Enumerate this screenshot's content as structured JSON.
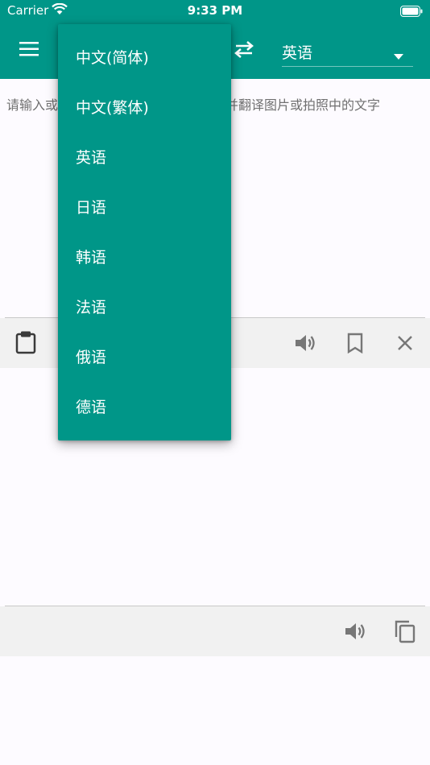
{
  "status": {
    "carrier": "Carrier",
    "time": "9:33 PM"
  },
  "header": {
    "target_language": "英语"
  },
  "input": {
    "placeholder": "请输入或粘贴要翻译的文字，也可识别并翻译图片或拍照中的文字"
  },
  "language_menu": {
    "items": [
      "中文(简体)",
      "中文(繁体)",
      "英语",
      "日语",
      "韩语",
      "法语",
      "俄语",
      "德语"
    ]
  },
  "colors": {
    "primary": "#009688",
    "toolbar": "#f1f1f1",
    "icon": "#777777"
  }
}
